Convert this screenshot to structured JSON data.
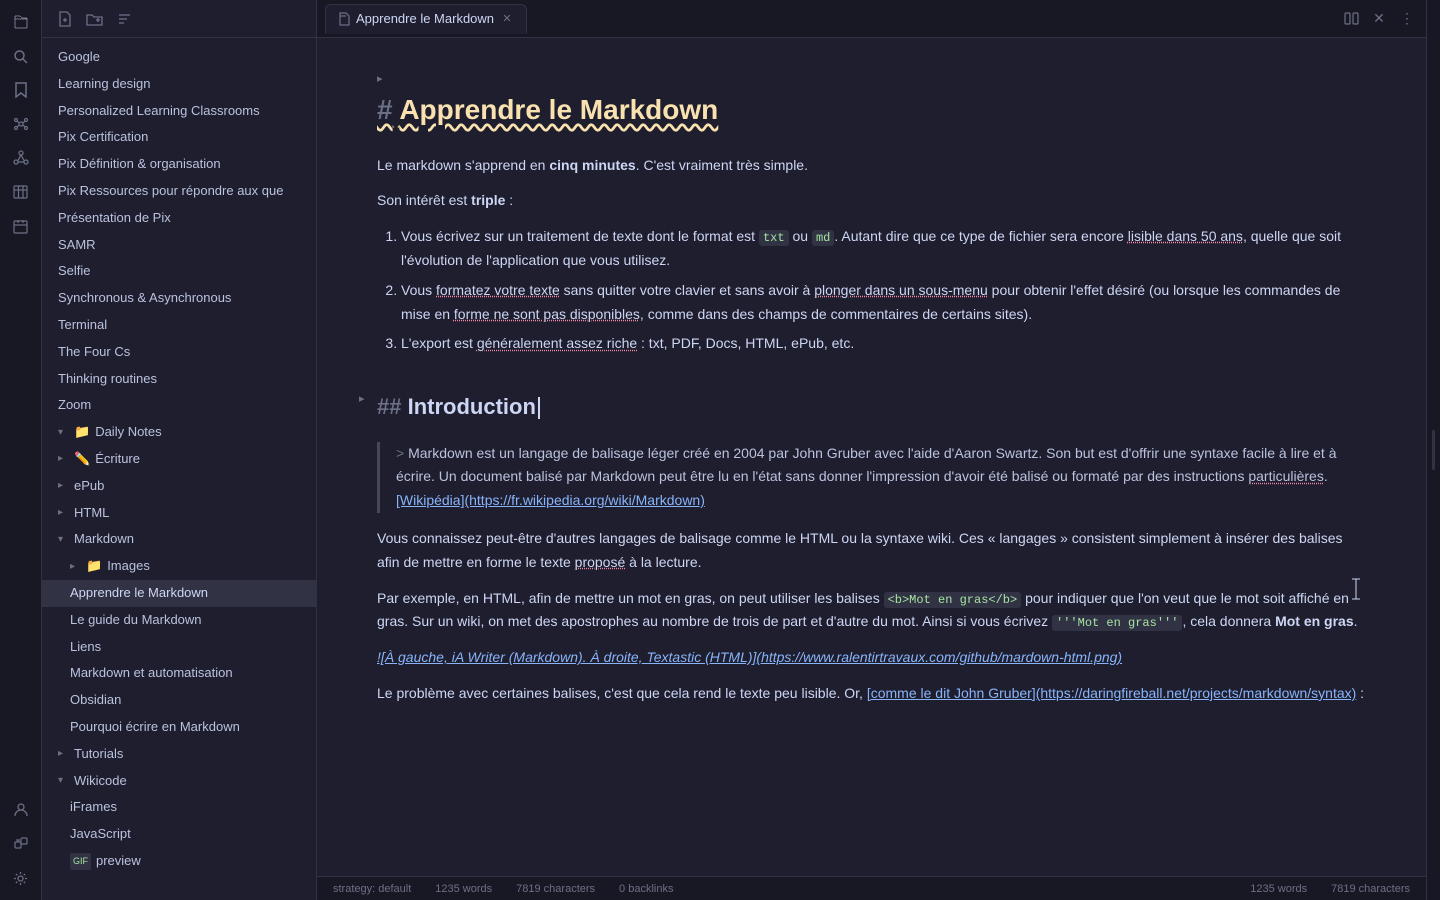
{
  "app": {
    "title": "Apprendre le Markdown"
  },
  "icon_rail": {
    "icons": [
      {
        "name": "files-icon",
        "symbol": "📁",
        "active": false
      },
      {
        "name": "search-icon",
        "symbol": "🔍",
        "active": false
      },
      {
        "name": "bookmarks-icon",
        "symbol": "★",
        "active": false
      },
      {
        "name": "graph-icon",
        "symbol": "⬡",
        "active": false
      },
      {
        "name": "connections-icon",
        "symbol": "⚙",
        "active": false
      },
      {
        "name": "table-icon",
        "symbol": "⊞",
        "active": false
      },
      {
        "name": "calendar-icon",
        "symbol": "📅",
        "active": false
      },
      {
        "name": "person-icon",
        "symbol": "👤",
        "active": false
      },
      {
        "name": "plugin-icon",
        "symbol": "🧩",
        "active": false
      },
      {
        "name": "settings-icon",
        "symbol": "⚙",
        "active": false
      },
      {
        "name": "help-icon",
        "symbol": "?",
        "active": false
      }
    ]
  },
  "sidebar": {
    "toolbar": {
      "new_note": "📄",
      "new_folder": "📁",
      "sort": "⇅"
    },
    "items": [
      {
        "id": "google",
        "label": "Google",
        "level": 0,
        "type": "file"
      },
      {
        "id": "learning-design",
        "label": "Learning design",
        "level": 0,
        "type": "file"
      },
      {
        "id": "personalized",
        "label": "Personalized Learning Classrooms",
        "level": 0,
        "type": "file"
      },
      {
        "id": "pix-certification",
        "label": "Pix Certification",
        "level": 0,
        "type": "file"
      },
      {
        "id": "pix-definition",
        "label": "Pix Définition & organisation",
        "level": 0,
        "type": "file"
      },
      {
        "id": "pix-ressources",
        "label": "Pix Ressources pour répondre aux que",
        "level": 0,
        "type": "file"
      },
      {
        "id": "presentation-pix",
        "label": "Présentation de Pix",
        "level": 0,
        "type": "file"
      },
      {
        "id": "samr",
        "label": "SAMR",
        "level": 0,
        "type": "file"
      },
      {
        "id": "selfie",
        "label": "Selfie",
        "level": 0,
        "type": "file"
      },
      {
        "id": "synchronous",
        "label": "Synchronous & Asynchronous",
        "level": 0,
        "type": "file"
      },
      {
        "id": "terminal",
        "label": "Terminal",
        "level": 0,
        "type": "file"
      },
      {
        "id": "four-cs",
        "label": "The Four Cs",
        "level": 0,
        "type": "file"
      },
      {
        "id": "thinking-routines",
        "label": "Thinking routines",
        "level": 0,
        "type": "file"
      },
      {
        "id": "zoom",
        "label": "Zoom",
        "level": 0,
        "type": "file"
      },
      {
        "id": "daily-notes",
        "label": "Daily Notes",
        "level": 0,
        "type": "folder",
        "collapsed": false,
        "icon": "📁"
      },
      {
        "id": "ecriture",
        "label": "Écriture",
        "level": 0,
        "type": "folder",
        "collapsed": true,
        "icon": "✏️"
      },
      {
        "id": "epub",
        "label": "ePub",
        "level": 0,
        "type": "folder",
        "collapsed": true
      },
      {
        "id": "html",
        "label": "HTML",
        "level": 0,
        "type": "folder",
        "collapsed": true
      },
      {
        "id": "markdown",
        "label": "Markdown",
        "level": 0,
        "type": "folder",
        "collapsed": false
      },
      {
        "id": "images",
        "label": "Images",
        "level": 1,
        "type": "folder",
        "collapsed": true
      },
      {
        "id": "apprendre-markdown",
        "label": "Apprendre le Markdown",
        "level": 1,
        "type": "file",
        "active": true
      },
      {
        "id": "guide-markdown",
        "label": "Le guide du Markdown",
        "level": 1,
        "type": "file"
      },
      {
        "id": "liens",
        "label": "Liens",
        "level": 1,
        "type": "file"
      },
      {
        "id": "markdown-automatisation",
        "label": "Markdown et automatisation",
        "level": 1,
        "type": "file"
      },
      {
        "id": "obsidian",
        "label": "Obsidian",
        "level": 1,
        "type": "file"
      },
      {
        "id": "pourquoi-markdown",
        "label": "Pourquoi écrire en Markdown",
        "level": 1,
        "type": "file"
      },
      {
        "id": "tutorials",
        "label": "Tutorials",
        "level": 0,
        "type": "folder",
        "collapsed": true
      },
      {
        "id": "wikicode",
        "label": "Wikicode",
        "level": 0,
        "type": "folder",
        "collapsed": false
      },
      {
        "id": "iframes",
        "label": "iFrames",
        "level": 1,
        "type": "file"
      },
      {
        "id": "javascript",
        "label": "JavaScript",
        "level": 1,
        "type": "file"
      },
      {
        "id": "gif-preview",
        "label": "preview",
        "level": 1,
        "type": "file",
        "badge": "GIF"
      }
    ]
  },
  "editor": {
    "h1_prefix": "#",
    "h1_title": "Apprendre le Markdown",
    "intro_p1_before": "Le markdown s'apprend en ",
    "intro_p1_bold": "cinq minutes",
    "intro_p1_after": ". C'est vraiment très simple.",
    "intro_p2_before": "Son intérêt est ",
    "intro_p2_bold": "triple",
    "intro_p2_after": " :",
    "list_items": [
      "Vous écrivez sur un traitement de texte dont le format est `txt` ou `md`. Autant dire que ce type de fichier sera encore lisible dans 50 ans, quelle que soit l'évolution de l'application que vous utilisez.",
      "Vous formatez votre texte sans quitter votre clavier et sans avoir à plonger dans un sous-menu pour obtenir l'effet désiré (ou lorsque les commandes de mise en forme ne sont pas disponibles, comme dans des champs de commentaires de certains sites).",
      "L'export est généralement assez riche : txt, PDF, Docs, HTML, ePub, etc."
    ],
    "h2_prefix": "##",
    "h2_title": "Introduction",
    "blockquote": "Markdown est un langage de balisage léger créé en 2004 par John Gruber avec l'aide d'Aaron Swartz. Son but est d'offrir une syntaxe facile à lire et à écrire. Un document balisé par Markdown peut être lu en l'état sans donner l'impression d'avoir été balisé ou formaté par des instructions particulières. [Wikipédia](https://fr.wikipedia.org/wiki/Markdown)",
    "para1": "Vous connaissez peut-être d'autres langages de balisage comme le HTML ou la syntaxe wiki. Ces « langages » consistent simplement à insérer des balises afin de mettre en forme le texte proposé à la lecture.",
    "para2_before": "Par exemple, en HTML, afin de mettre un mot en gras, on peut utiliser les balises ",
    "para2_code1": "<b>Mot en gras</b>",
    "para2_after1": " pour indiquer que l'on veut que le mot soit affiché en gras. Sur un wiki, on met des apostrophes au nombre de trois de part et d'autre du mot. Ainsi si vous écrivez ",
    "para2_code2": "'''Mot en gras'''",
    "para2_after2": ", cela donnera ",
    "para2_bold": "Mot en gras",
    "para2_end": ".",
    "caption": "![À gauche, iA Writer (Markdown). À droite, Textastic (HTML)](https://www.ralentirtravaux.com/github/mardown-html.png)",
    "para3_before": "Le problème avec certaines balises, c'est que cela rend le texte peu lisible. Or, [comme le dit John Gruber](https://daringfireball.net/projects/markdown/syntax) :"
  },
  "status_bar": {
    "strategy": "strategy: default",
    "words1": "1235 words",
    "chars1": "7819 characters",
    "backlinks": "0 backlinks",
    "words2": "1235 words",
    "chars2": "7819 characters"
  },
  "colors": {
    "accent": "#f9e2af",
    "active_bg": "#313244",
    "sidebar_bg": "#1e1e2e",
    "editor_bg": "#1e1e2e"
  }
}
